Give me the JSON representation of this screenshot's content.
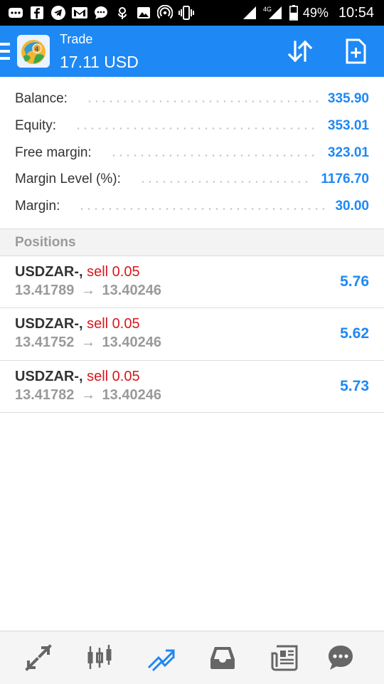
{
  "status_bar": {
    "battery": "49%",
    "time": "10:54",
    "network": "4G",
    "icons": [
      "more-icon",
      "facebook-icon",
      "telegram-icon",
      "gmail-icon",
      "chat-bubble-icon",
      "flower-icon",
      "image-icon",
      "hotspot-icon",
      "vibrate-icon",
      "signal-icon",
      "battery-icon"
    ]
  },
  "app_bar": {
    "title": "Trade",
    "subtitle": "17.11 USD",
    "accent_color": "#1e88f5"
  },
  "summary": [
    {
      "label": "Balance:",
      "value": "335.90"
    },
    {
      "label": "Equity:",
      "value": "353.01"
    },
    {
      "label": "Free margin:",
      "value": "323.01"
    },
    {
      "label": "Margin Level (%):",
      "value": "1176.70"
    },
    {
      "label": "Margin:",
      "value": "30.00"
    }
  ],
  "positions_header": "Positions",
  "positions": [
    {
      "symbol": "USDZAR-,",
      "type": "sell 0.05",
      "open_price": "13.41789",
      "arrow": "→",
      "current_price": "13.40246",
      "profit": "5.76"
    },
    {
      "symbol": "USDZAR-,",
      "type": "sell 0.05",
      "open_price": "13.41752",
      "arrow": "→",
      "current_price": "13.40246",
      "profit": "5.62"
    },
    {
      "symbol": "USDZAR-,",
      "type": "sell 0.05",
      "open_price": "13.41782",
      "arrow": "→",
      "current_price": "13.40246",
      "profit": "5.73"
    }
  ],
  "bottom_nav": [
    {
      "name": "quotes-icon",
      "active": false
    },
    {
      "name": "chart-icon",
      "active": false
    },
    {
      "name": "trade-icon",
      "active": true
    },
    {
      "name": "history-icon",
      "active": false
    },
    {
      "name": "news-icon",
      "active": false
    },
    {
      "name": "messages-icon",
      "active": false
    }
  ],
  "colors": {
    "value_blue": "#1e88f5",
    "sell_red": "#d8181c",
    "muted_gray": "#9a9a9a"
  }
}
